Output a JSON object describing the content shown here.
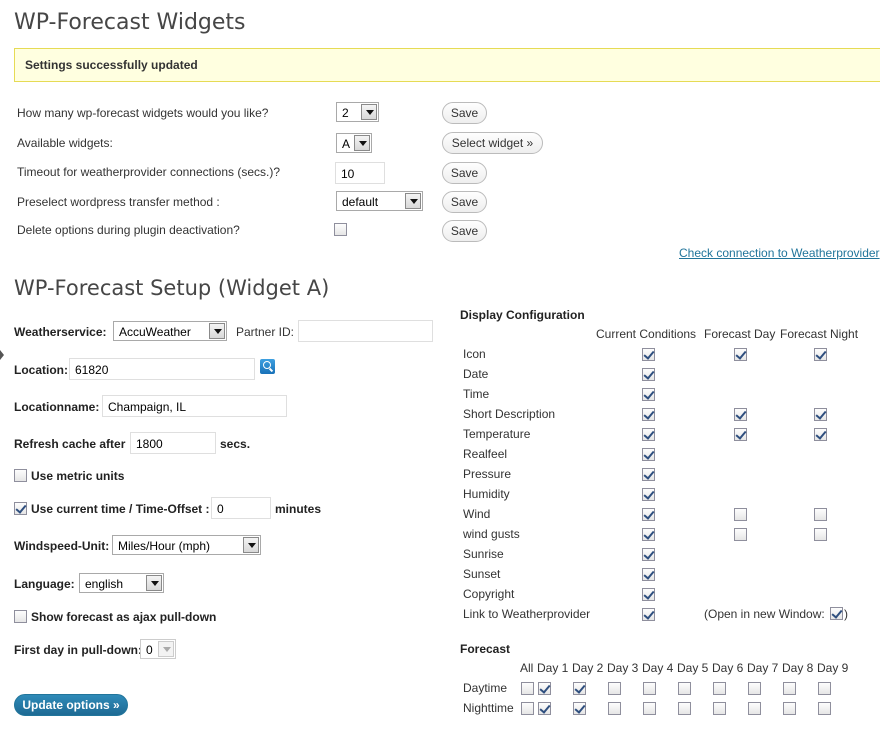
{
  "page_title": "WP-Forecast Widgets",
  "notice": "Settings successfully updated",
  "general": {
    "widget_count_label": "How many wp-forecast widgets would you like?",
    "widget_count_value": "2",
    "available_label": "Available widgets:",
    "available_value": "A",
    "select_widget_button": "Select widget »",
    "timeout_label": "Timeout for weatherprovider connections (secs.)?",
    "timeout_value": "10",
    "transfer_label": "Preselect wordpress transfer method :",
    "transfer_value": "default",
    "delete_label": "Delete options during plugin deactivation?",
    "save_label": "Save",
    "check_link": "Check connection to Weatherprovider"
  },
  "setup": {
    "title": "WP-Forecast Setup (Widget A)",
    "weatherservice_label": "Weatherservice:",
    "weatherservice_value": "AccuWeather",
    "partner_label": "Partner ID:",
    "partner_value": "",
    "location_label": "Location:",
    "location_value": "61820",
    "locationname_label": "Locationname:",
    "locationname_value": "Champaign, IL",
    "refresh_label": "Refresh cache after",
    "refresh_value": "1800",
    "refresh_unit": "secs.",
    "metric_label": "Use metric units",
    "metric_checked": false,
    "time_label": "Use current time / Time-Offset :",
    "time_checked": true,
    "time_value": "0",
    "time_unit": "minutes",
    "windspeed_label": "Windspeed-Unit:",
    "windspeed_value": "Miles/Hour (mph)",
    "language_label": "Language:",
    "language_value": "english",
    "ajax_label": "Show forecast as ajax pull-down",
    "ajax_checked": false,
    "firstday_label": "First day in pull-down:",
    "firstday_value": "0",
    "update_button": "Update options »"
  },
  "display": {
    "title": "Display Configuration",
    "col_current": "Current Conditions",
    "col_day": "Forecast Day",
    "col_night": "Forecast Night",
    "rows": [
      {
        "label": "Icon",
        "current": true,
        "day": true,
        "night": true
      },
      {
        "label": "Date",
        "current": true,
        "day": null,
        "night": null
      },
      {
        "label": "Time",
        "current": true,
        "day": null,
        "night": null
      },
      {
        "label": "Short Description",
        "current": true,
        "day": true,
        "night": true
      },
      {
        "label": "Temperature",
        "current": true,
        "day": true,
        "night": true
      },
      {
        "label": "Realfeel",
        "current": true,
        "day": null,
        "night": null
      },
      {
        "label": "Pressure",
        "current": true,
        "day": null,
        "night": null
      },
      {
        "label": "Humidity",
        "current": true,
        "day": null,
        "night": null
      },
      {
        "label": "Wind",
        "current": true,
        "day": false,
        "night": false
      },
      {
        "label": "wind gusts",
        "current": true,
        "day": false,
        "night": false
      },
      {
        "label": "Sunrise",
        "current": true,
        "day": null,
        "night": null
      },
      {
        "label": "Sunset",
        "current": true,
        "day": null,
        "night": null
      },
      {
        "label": "Copyright",
        "current": true,
        "day": null,
        "night": null
      },
      {
        "label": "Link to Weatherprovider",
        "current": true,
        "day": null,
        "night": null
      }
    ],
    "open_new_window_label": "(Open in new Window:",
    "open_new_window_checked": true,
    "open_new_window_close": ")"
  },
  "forecast": {
    "title": "Forecast",
    "headers": [
      "All",
      "Day 1",
      "Day 2",
      "Day 3",
      "Day 4",
      "Day 5",
      "Day 6",
      "Day 7",
      "Day 8",
      "Day 9"
    ],
    "rows": [
      {
        "label": "Daytime",
        "checks": [
          false,
          true,
          true,
          false,
          false,
          false,
          false,
          false,
          false,
          false
        ]
      },
      {
        "label": "Nighttime",
        "checks": [
          false,
          true,
          true,
          false,
          false,
          false,
          false,
          false,
          false,
          false
        ]
      }
    ]
  }
}
